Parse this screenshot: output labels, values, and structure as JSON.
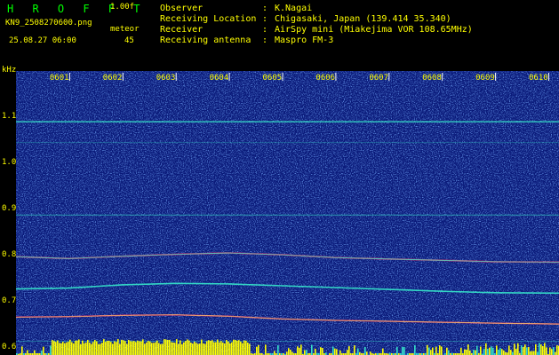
{
  "header": {
    "brand": "H R O F F T",
    "version": "1.00f",
    "filename": "KN9_2508270600.png",
    "meteor_label": "meteor",
    "datetime": "25.08.27 06:00",
    "meteor_count": "45"
  },
  "info": [
    {
      "key": "Observer",
      "value": "K.Nagai"
    },
    {
      "key": "Receiving Location",
      "value": "Chigasaki, Japan (139.414 35.340)"
    },
    {
      "key": "Receiver",
      "value": "AirSpy mini (Miakejima VOR 108.65MHz)"
    },
    {
      "key": "Receiving antenna",
      "value": "Maspro FM-3"
    }
  ],
  "spectrogram": {
    "freq_unit": "kHz",
    "y_ticks": [
      "1.1",
      "1.0",
      "0.9",
      "0.8",
      "0.7",
      "0.6"
    ],
    "y_tick_values": [
      1.1,
      1.0,
      0.9,
      0.8,
      0.7,
      0.6
    ],
    "y_range": [
      0.585,
      1.2
    ],
    "time_ticks": [
      "0601",
      "0602",
      "0603",
      "0604",
      "0605",
      "0606",
      "0607",
      "0608",
      "0609",
      "0610"
    ],
    "time_range_minutes": [
      0,
      10.2
    ],
    "colors": {
      "background": "#0a1a7a",
      "noise": "#2f6cff",
      "signal": "#35e0c8",
      "strong": "#ff3a6a",
      "meteor": "#ffff00",
      "label": "#ffff00"
    }
  }
}
